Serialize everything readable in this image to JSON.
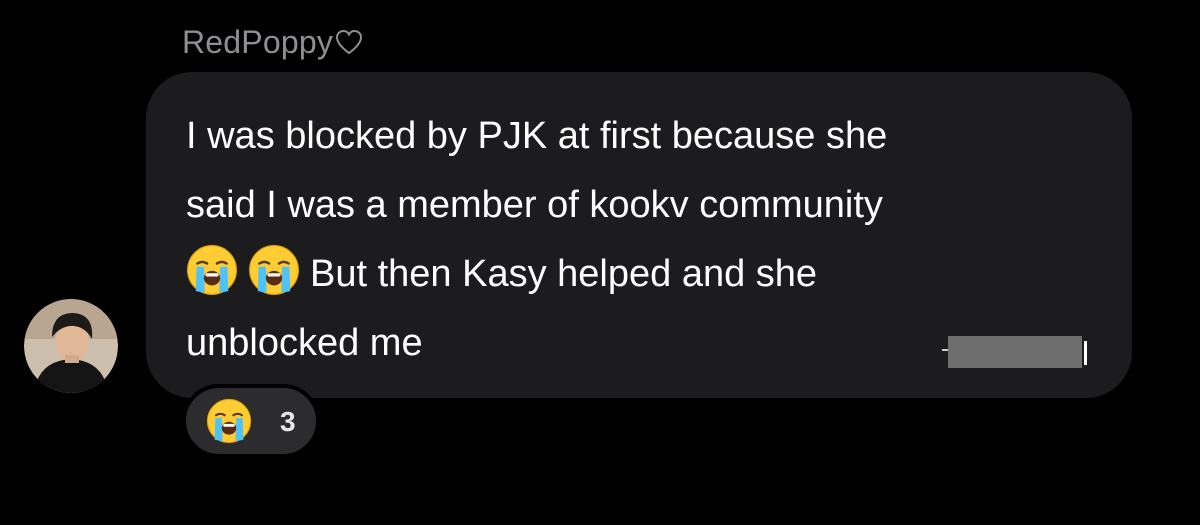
{
  "thread": {
    "sender_name": "RedPoppy",
    "sender_badge_icon": "heart-outline-icon",
    "avatar_icon": "user-avatar-photo"
  },
  "message": {
    "line1": "I was blocked by PJK at first because she",
    "line2": "said I was a member of kookv community",
    "line3_emojis": [
      "loudly-crying-face-emoji",
      "loudly-crying-face-emoji"
    ],
    "line3_text": "But then Kasy helped and she",
    "line4": "unblocked me"
  },
  "reaction": {
    "emoji": "loudly-crying-face-emoji",
    "count": "3"
  },
  "colors": {
    "background": "#000000",
    "bubble": "#1c1c1e",
    "reaction_pill": "#2c2c2e",
    "name_text": "#8e8e93",
    "message_text": "#ffffff"
  }
}
